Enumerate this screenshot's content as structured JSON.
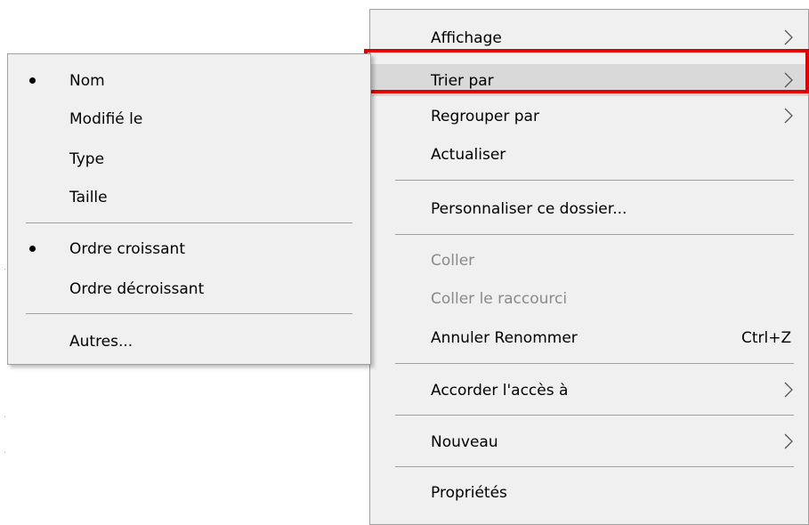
{
  "main_menu": {
    "items": [
      {
        "label": "Affichage",
        "submenu": true
      },
      {
        "label": "Trier par",
        "submenu": true,
        "highlighted": true
      },
      {
        "label": "Regrouper par",
        "submenu": true
      },
      {
        "label": "Actualiser"
      },
      {
        "label": "Personnaliser ce dossier..."
      },
      {
        "label": "Coller",
        "disabled": true
      },
      {
        "label": "Coller le raccourci",
        "disabled": true
      },
      {
        "label": "Annuler Renommer",
        "shortcut": "Ctrl+Z"
      },
      {
        "label": "Accorder l'accès à",
        "submenu": true
      },
      {
        "label": "Nouveau",
        "submenu": true
      },
      {
        "label": "Propriétés"
      }
    ]
  },
  "sort_submenu": {
    "items": [
      {
        "label": "Nom",
        "checked": true
      },
      {
        "label": "Modifié le"
      },
      {
        "label": "Type"
      },
      {
        "label": "Taille"
      },
      {
        "label": "Ordre croissant",
        "checked": true
      },
      {
        "label": "Ordre décroissant"
      },
      {
        "label": "Autres..."
      }
    ]
  },
  "colors": {
    "menu_bg": "#f0f0f0",
    "hover_bg": "#d9d9d9",
    "highlight_frame": "#e00000",
    "disabled_text": "#8a8a8a"
  }
}
